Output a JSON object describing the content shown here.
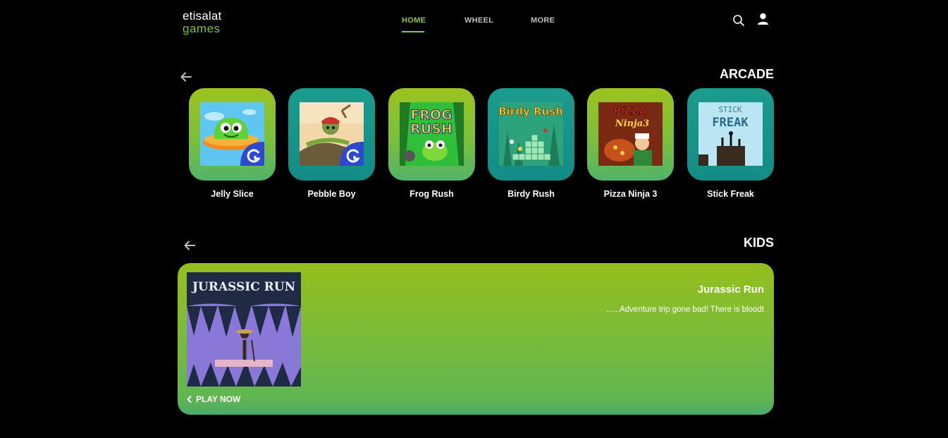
{
  "brand": {
    "line1": "etisalat",
    "line2": "games"
  },
  "nav": {
    "home": "HOME",
    "wheel": "WHEEL",
    "more": "MORE",
    "active": "home"
  },
  "header_icons": [
    "search-icon",
    "user-icon"
  ],
  "colors": {
    "accent": "#8dc63f",
    "lime_tile": "#9cc31f",
    "teal_tile": "#1a9c8e",
    "background": "#000000"
  },
  "arcade": {
    "title": "ARCADE",
    "games": [
      {
        "name": "Jelly Slice",
        "tile": "lime",
        "badge": true
      },
      {
        "name": "Pebble Boy",
        "tile": "teal",
        "badge": true
      },
      {
        "name": "Frog Rush",
        "tile": "lime",
        "badge": false
      },
      {
        "name": "Birdy Rush",
        "tile": "teal",
        "badge": false
      },
      {
        "name": "Pizza Ninja 3",
        "tile": "lime",
        "badge": false
      },
      {
        "name": "Stick Freak",
        "tile": "teal",
        "badge": false
      }
    ]
  },
  "thumb_text": {
    "frog": [
      "FROG",
      "RUSH"
    ],
    "birdy": "Birdy Rush",
    "pizza": [
      "PIZZA",
      "Ninja3"
    ],
    "stick": [
      "STICK",
      "FREAK"
    ],
    "jurassic": "JURASSIC RUN"
  },
  "kids": {
    "title": "KIDS",
    "featured": {
      "name": "Jurassic Run",
      "description": "......Adventure trip gone bad! There is bloodt",
      "cta": "PLAY NOW"
    }
  }
}
